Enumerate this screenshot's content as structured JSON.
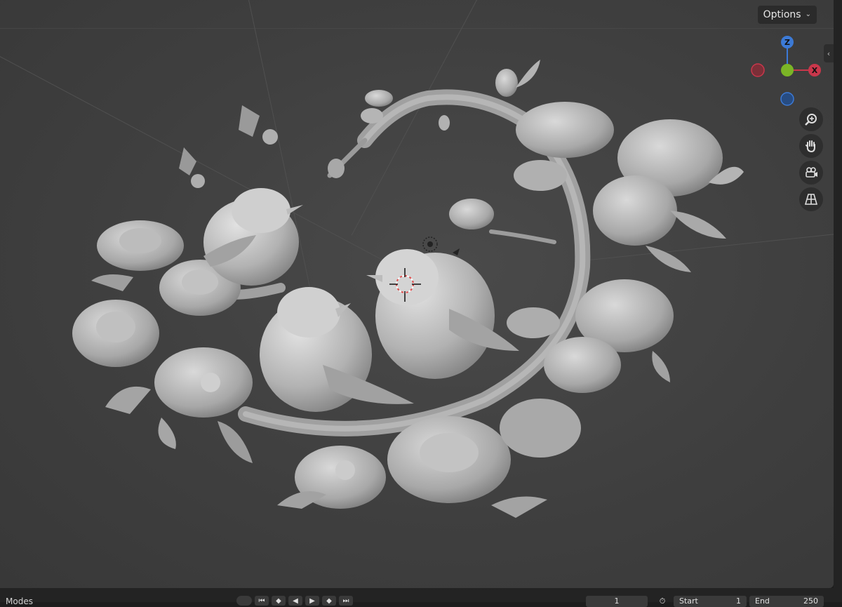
{
  "header": {
    "options_label": "Options",
    "options_chevron": "chevron-down-icon"
  },
  "gizmo": {
    "z_label": "Z",
    "x_label": "X",
    "colors": {
      "x": "#c9374b",
      "y": "#7bb526",
      "z": "#3c7ad6"
    }
  },
  "nav_tools": [
    "zoom-icon",
    "hand-pan-icon",
    "camera-view-icon",
    "perspective-grid-icon"
  ],
  "timeline": {
    "mode_label": "Modes",
    "current_frame": "1",
    "start_label": "Start",
    "start_value": "1",
    "end_label": "End",
    "end_value": "250"
  }
}
